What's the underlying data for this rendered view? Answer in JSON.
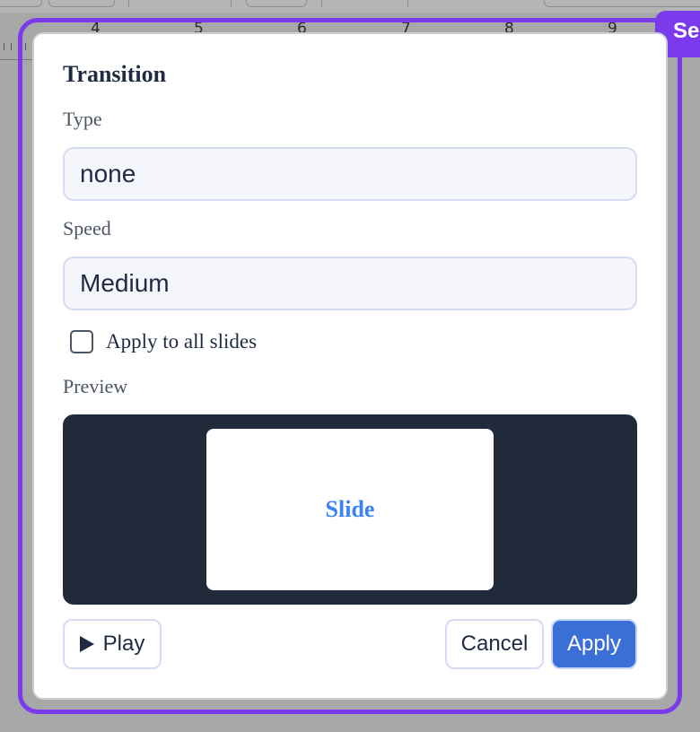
{
  "ruler": {
    "marks": [
      "4",
      "5",
      "6",
      "7",
      "8",
      "9"
    ]
  },
  "selection": {
    "badge_label": "Se"
  },
  "dialog": {
    "title": "Transition",
    "type": {
      "label": "Type",
      "value": "none"
    },
    "speed": {
      "label": "Speed",
      "value": "Medium"
    },
    "apply_all": {
      "label": "Apply to all slides",
      "checked": false
    },
    "preview": {
      "label": "Preview",
      "slide_text": "Slide"
    },
    "buttons": {
      "play_label": "Play",
      "cancel_label": "Cancel",
      "apply_label": "Apply"
    }
  },
  "colors": {
    "accent_purple": "#7c3aed",
    "apply_blue": "#3b6fd8",
    "preview_bg": "#202a3a",
    "slide_text": "#3b82f6"
  },
  "icons": {
    "play": "play-icon"
  }
}
